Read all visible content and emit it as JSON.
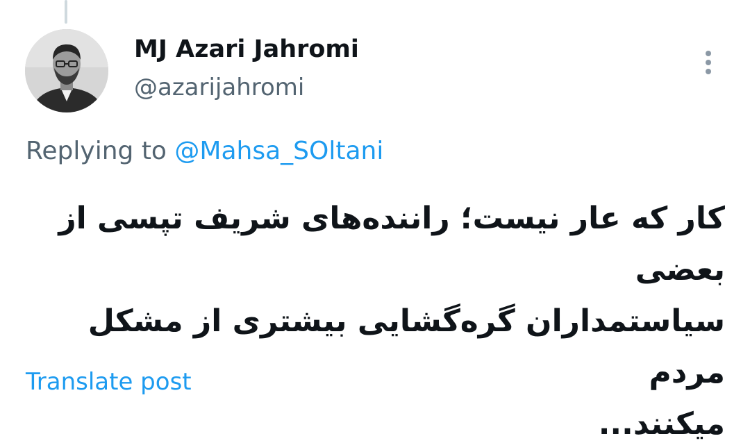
{
  "post": {
    "author_name": "MJ Azari Jahromi",
    "author_handle": "@azarijahromi",
    "replying_prefix": "Replying to",
    "replying_to": "@Mahsa_SOltani",
    "text_line1": "کار که عار نیست؛ راننده‌های شریف تپسی از بعضی",
    "text_line2": "سیاستمداران گره‌گشایی بیشتری از مشکل مردم",
    "text_line3": "میکنند...",
    "translate_label": "Translate post"
  },
  "icons": {
    "more": "more-vertical-icon",
    "avatar": "profile-photo"
  },
  "colors": {
    "link": "#1d9bf0",
    "secondary_text": "#536471",
    "primary_text": "#0f1419"
  }
}
